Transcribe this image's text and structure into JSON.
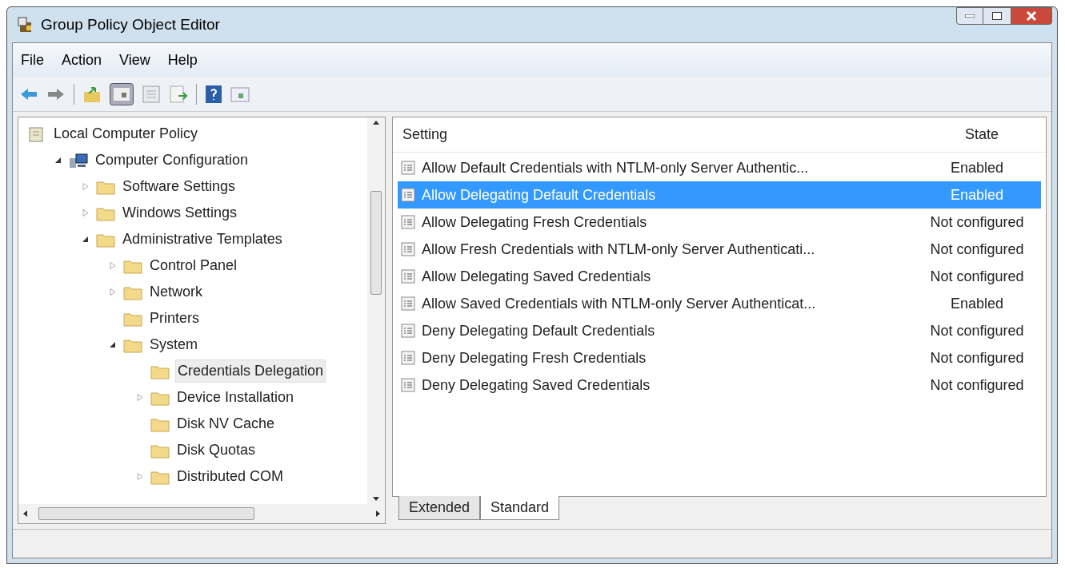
{
  "window": {
    "title": "Group Policy Object Editor"
  },
  "menu": [
    "File",
    "Action",
    "View",
    "Help"
  ],
  "tree": [
    {
      "label": "Local Computer Policy",
      "selected": false,
      "children": [
        {
          "label": "Computer Configuration",
          "expanded": true,
          "selected": false,
          "children": [
            {
              "label": "Software Settings",
              "expanded": false,
              "selected": false
            },
            {
              "label": "Windows Settings",
              "expanded": false,
              "selected": false
            },
            {
              "label": "Administrative Templates",
              "expanded": true,
              "selected": false,
              "children": [
                {
                  "label": "Control Panel",
                  "expanded": false,
                  "selected": false
                },
                {
                  "label": "Network",
                  "expanded": false,
                  "selected": false
                },
                {
                  "label": "Printers",
                  "selected": false
                },
                {
                  "label": "System",
                  "expanded": true,
                  "selected": false,
                  "children": [
                    {
                      "label": "Credentials Delegation",
                      "selected": true
                    },
                    {
                      "label": "Device Installation",
                      "expanded": false,
                      "selected": false
                    },
                    {
                      "label": "Disk NV Cache",
                      "selected": false
                    },
                    {
                      "label": "Disk Quotas",
                      "selected": false
                    },
                    {
                      "label": "Distributed COM",
                      "expanded": false,
                      "selected": false
                    }
                  ]
                }
              ]
            }
          ]
        }
      ]
    }
  ],
  "table": {
    "columns": [
      "Setting",
      "State"
    ],
    "rows": [
      {
        "setting": "Allow Default Credentials with NTLM-only Server Authentic...",
        "state": "Enabled",
        "selected": false
      },
      {
        "setting": "Allow Delegating Default Credentials",
        "state": "Enabled",
        "selected": true
      },
      {
        "setting": "Allow Delegating Fresh Credentials",
        "state": "Not configured",
        "selected": false
      },
      {
        "setting": "Allow Fresh Credentials with NTLM-only Server Authenticati...",
        "state": "Not configured",
        "selected": false
      },
      {
        "setting": "Allow Delegating Saved Credentials",
        "state": "Not configured",
        "selected": false
      },
      {
        "setting": "Allow Saved Credentials with NTLM-only Server Authenticat...",
        "state": "Enabled",
        "selected": false
      },
      {
        "setting": "Deny Delegating Default Credentials",
        "state": "Not configured",
        "selected": false
      },
      {
        "setting": "Deny Delegating Fresh Credentials",
        "state": "Not configured",
        "selected": false
      },
      {
        "setting": "Deny Delegating Saved Credentials",
        "state": "Not configured",
        "selected": false
      }
    ]
  },
  "view_tabs": [
    {
      "label": "Extended",
      "selected": false
    },
    {
      "label": "Standard",
      "selected": true
    }
  ]
}
